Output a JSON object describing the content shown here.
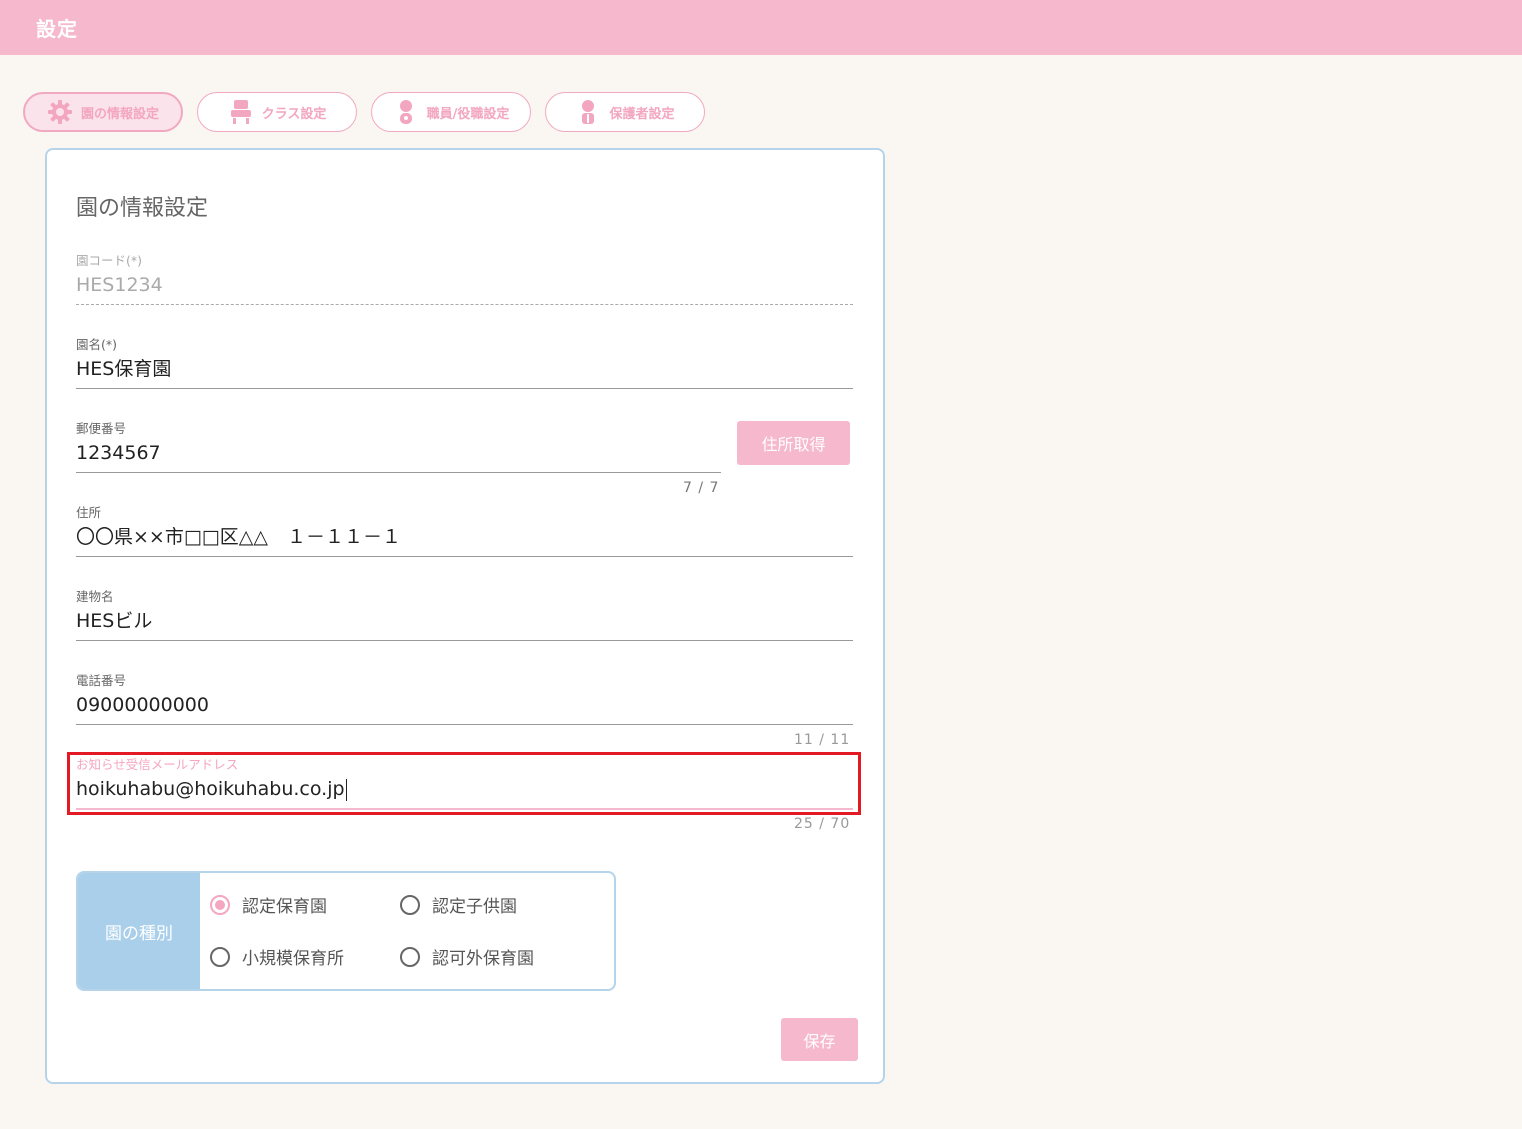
{
  "header": {
    "title": "設定"
  },
  "tabs": [
    {
      "label": "園の情報設定",
      "icon": "gear-icon",
      "active": true
    },
    {
      "label": "クラス設定",
      "icon": "teacher-icon",
      "active": false
    },
    {
      "label": "職員/役職設定",
      "icon": "staff-icon",
      "active": false
    },
    {
      "label": "保護者設定",
      "icon": "parent-icon",
      "active": false
    }
  ],
  "card": {
    "title": "園の情報設定"
  },
  "fields": {
    "code": {
      "label": "園コード(*)",
      "value": "HES1234"
    },
    "name": {
      "label": "園名(*)",
      "value": "HES保育園"
    },
    "postal": {
      "label": "郵便番号",
      "value": "1234567",
      "counter": "7 / 7"
    },
    "address": {
      "label": "住所",
      "value": "〇〇県××市□□区△△　１－１１－１"
    },
    "building": {
      "label": "建物名",
      "value": "HESビル"
    },
    "phone": {
      "label": "電話番号",
      "value": "09000000000",
      "counter": "11 / 11"
    },
    "email": {
      "label": "お知らせ受信メールアドレス",
      "value": "hoikuhabu@hoikuhabu.co.jp",
      "counter": "25 / 70"
    }
  },
  "buttons": {
    "get_address": "住所取得",
    "save": "保存"
  },
  "type_section": {
    "label": "園の種別",
    "options": [
      {
        "label": "認定保育園",
        "checked": true
      },
      {
        "label": "認定子供園",
        "checked": false
      },
      {
        "label": "小規模保育所",
        "checked": false
      },
      {
        "label": "認可外保育園",
        "checked": false
      }
    ]
  },
  "colors": {
    "header": "#f5b8cc",
    "accent_pink": "#f5a6c0",
    "accent_blue": "#aacfea",
    "highlight": "#e31923"
  }
}
